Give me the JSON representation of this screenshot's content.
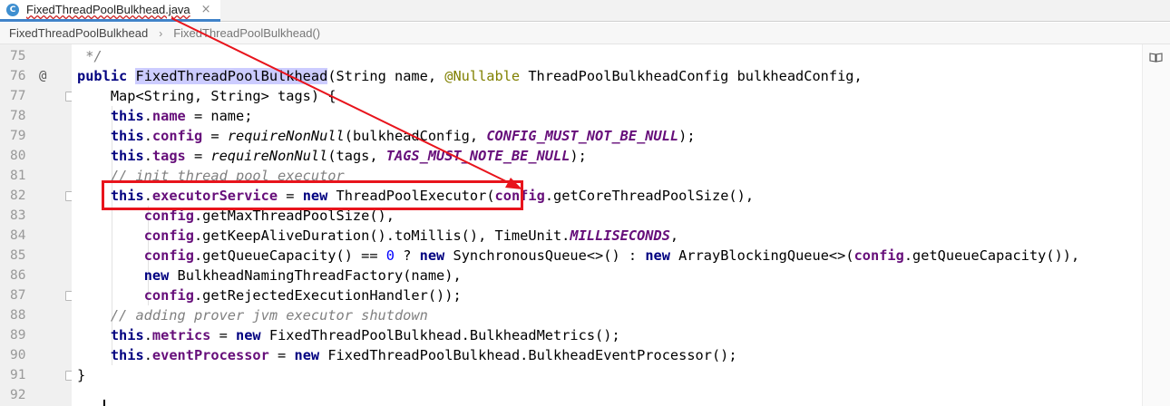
{
  "tab": {
    "icon_letter": "C",
    "filename": "FixedThreadPoolBulkhead.java",
    "close": "×"
  },
  "breadcrumb": {
    "items": [
      "FixedThreadPoolBulkhead",
      "FixedThreadPoolBulkhead()"
    ],
    "separator": "›"
  },
  "gutter": {
    "line_numbers": [
      "75",
      "76",
      "77",
      "78",
      "79",
      "80",
      "81",
      "82",
      "83",
      "84",
      "85",
      "86",
      "87",
      "88",
      "89",
      "90",
      "91",
      "92"
    ],
    "override_marker": "@"
  },
  "code": {
    "l75": " */",
    "l76": {
      "kw": "public",
      "name": "FixedThreadPoolBulkhead",
      "a": "(String name, ",
      "ann": "@Nullable",
      "b": " ThreadPoolBulkheadConfig bulkheadConfig,"
    },
    "l77": "    Map<String, String> tags) {",
    "l78": {
      "kw": "this",
      "dot": ".",
      "fld": "name",
      "rest": " = name;"
    },
    "l79": {
      "kw": "this",
      "dot": ".",
      "fld": "config",
      "eq": " = ",
      "call": "requireNonNull",
      "mid": "(bulkheadConfig, ",
      "const": "CONFIG_MUST_NOT_BE_NULL",
      "end": ");"
    },
    "l80": {
      "kw": "this",
      "dot": ".",
      "fld": "tags",
      "eq": " = ",
      "call": "requireNonNull",
      "mid": "(tags, ",
      "const": "TAGS_MUST_NOTE_BE_NULL",
      "end": ");"
    },
    "l81": "// init thread pool executor",
    "l82": {
      "kw": "this",
      "dot": ".",
      "fld": "executorService",
      "eq": " = ",
      "new": "new",
      "rest": " ThreadPoolExecutor(",
      "fld2": "config",
      "rest2": ".getCoreThreadPoolSize(),"
    },
    "l83": {
      "fld": "config",
      "rest": ".getMaxThreadPoolSize(),"
    },
    "l84": {
      "fld": "config",
      "rest": ".getKeepAliveDuration().toMillis(), TimeUnit.",
      "const": "MILLISECONDS",
      "end": ","
    },
    "l85": {
      "fld": "config",
      "a": ".getQueueCapacity() == ",
      "num": "0",
      "b": " ? ",
      "new1": "new",
      "c": " SynchronousQueue<>() : ",
      "new2": "new",
      "d": " ArrayBlockingQueue<>(",
      "fld2": "config",
      "e": ".getQueueCapacity()),"
    },
    "l86": {
      "new": "new",
      "rest": " BulkheadNamingThreadFactory(name),"
    },
    "l87": {
      "fld": "config",
      "rest": ".getRejectedExecutionHandler());"
    },
    "l88": "// adding prover jvm executor shutdown",
    "l89": {
      "kw": "this",
      "dot": ".",
      "fld": "metrics",
      "eq": " = ",
      "new": "new",
      "rest": " FixedThreadPoolBulkhead.BulkheadMetrics();"
    },
    "l90": {
      "kw": "this",
      "dot": ".",
      "fld": "eventProcessor",
      "eq": " = ",
      "new": "new",
      "rest": " FixedThreadPoolBulkhead.BulkheadEventProcessor();"
    },
    "l91": "}",
    "l92": ""
  },
  "colors": {
    "keyword": "#000080",
    "field": "#660e7a",
    "comment": "#808080",
    "annotation": "#808000",
    "number": "#0000ff",
    "highlight": "#ccccff",
    "annotation_red": "#e8141c"
  },
  "icons": {
    "tab_icon": "java-class-icon",
    "reader_mode": "book-icon"
  }
}
